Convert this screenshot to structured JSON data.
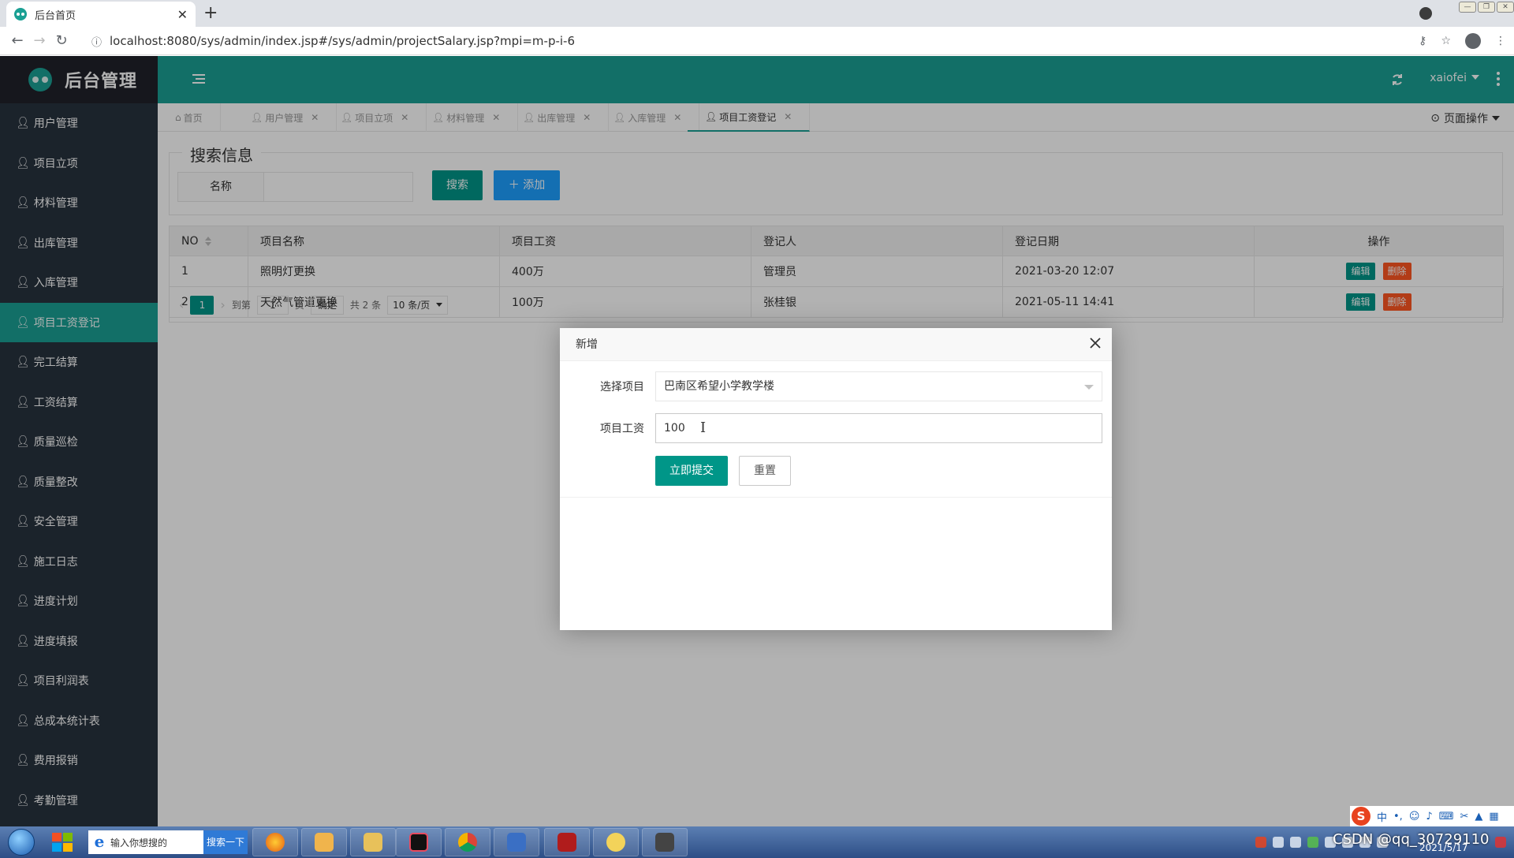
{
  "browser": {
    "tab_title": "后台首页",
    "url": "localhost:8080/sys/admin/index.jsp#/sys/admin/projectSalary.jsp?mpi=m-p-i-6"
  },
  "app": {
    "title": "后台管理",
    "username": "xaiofei"
  },
  "sidebar": {
    "items": [
      {
        "label": "用户管理"
      },
      {
        "label": "项目立项"
      },
      {
        "label": "材料管理"
      },
      {
        "label": "出库管理"
      },
      {
        "label": "入库管理"
      },
      {
        "label": "项目工资登记",
        "active": true
      },
      {
        "label": "完工结算"
      },
      {
        "label": "工资结算"
      },
      {
        "label": "质量巡检"
      },
      {
        "label": "质量整改"
      },
      {
        "label": "安全管理"
      },
      {
        "label": "施工日志"
      },
      {
        "label": "进度计划"
      },
      {
        "label": "进度填报"
      },
      {
        "label": "项目利润表"
      },
      {
        "label": "总成本统计表"
      },
      {
        "label": "费用报销"
      },
      {
        "label": "考勤管理"
      }
    ]
  },
  "tabs": {
    "items": [
      {
        "label": "首页",
        "icon": "home-icon"
      },
      {
        "label": "用户管理",
        "icon": "user-icon"
      },
      {
        "label": "项目立项",
        "icon": "user-icon"
      },
      {
        "label": "材料管理",
        "icon": "user-icon"
      },
      {
        "label": "出库管理",
        "icon": "user-icon"
      },
      {
        "label": "入库管理",
        "icon": "user-icon"
      },
      {
        "label": "项目工资登记",
        "icon": "user-icon",
        "active": true
      }
    ],
    "page_ops": "页面操作"
  },
  "search": {
    "legend": "搜索信息",
    "name_label": "名称",
    "search_btn": "搜索",
    "add_btn": "添加"
  },
  "table": {
    "headers": {
      "no": "NO",
      "name": "项目名称",
      "salary": "项目工资",
      "registrant": "登记人",
      "date": "登记日期",
      "ops": "操作"
    },
    "rows": [
      {
        "no": "1",
        "name": "照明灯更换",
        "salary": "400万",
        "registrant": "管理员",
        "date": "2021-03-20 12:07"
      },
      {
        "no": "2",
        "name": "天然气管道更换",
        "salary": "100万",
        "registrant": "张桂银",
        "date": "2021-05-11 14:41"
      }
    ],
    "edit_label": "编辑",
    "delete_label": "删除"
  },
  "pagination": {
    "current": "1",
    "goto": "到第",
    "page_input": "1",
    "page_suffix": "页",
    "confirm": "确定",
    "total": "共 2 条",
    "page_size": "10 条/页"
  },
  "modal": {
    "title": "新增",
    "project_label": "选择项目",
    "project_value": "巴南区希望小学教学楼",
    "salary_label": "项目工资",
    "salary_value": "100",
    "submit": "立即提交",
    "reset": "重置"
  },
  "taskbar": {
    "search_placeholder": "输入你想搜的",
    "search_btn": "搜索一下",
    "watermark": "CSDN @qq_30729110",
    "date": "2021/5/17",
    "ime_lang": "中"
  },
  "colors": {
    "primary": "#1aa094",
    "sidebar_bg": "#28333e",
    "logo_bg": "#20222a",
    "button_green": "#009688",
    "button_blue": "#1e9fff",
    "button_danger": "#ff5722"
  }
}
